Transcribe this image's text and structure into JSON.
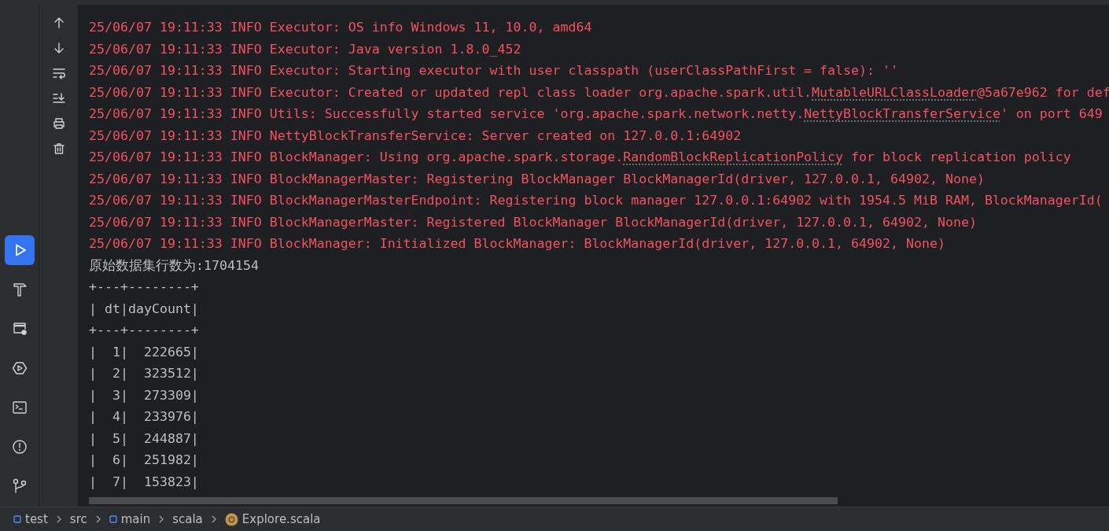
{
  "tool_windows": [
    {
      "kind": "run",
      "selected": true
    },
    {
      "kind": "build",
      "selected": false
    },
    {
      "kind": "services",
      "selected": false
    },
    {
      "kind": "deploy",
      "selected": false
    },
    {
      "kind": "terminal",
      "selected": false
    },
    {
      "kind": "problems",
      "selected": false
    },
    {
      "kind": "git",
      "selected": false
    }
  ],
  "console": {
    "lines": [
      {
        "kind": "log",
        "segments": [
          {
            "text": "25/06/07 19:11:33 INFO Executor: OS info Windows 11, 10.0, amd64"
          }
        ]
      },
      {
        "kind": "log",
        "segments": [
          {
            "text": "25/06/07 19:11:33 INFO Executor: Java version 1.8.0_452"
          }
        ]
      },
      {
        "kind": "log",
        "segments": [
          {
            "text": "25/06/07 19:11:33 INFO Executor: Starting executor with user classpath (userClassPathFirst = false): ''"
          }
        ]
      },
      {
        "kind": "log",
        "segments": [
          {
            "text": "25/06/07 19:11:33 INFO Executor: Created or updated repl class loader org.apache.spark.util."
          },
          {
            "text": "MutableURLClassLoader",
            "link": true
          },
          {
            "text": "@5a67e962 for def"
          }
        ]
      },
      {
        "kind": "log",
        "segments": [
          {
            "text": "25/06/07 19:11:33 INFO Utils: Successfully started service 'org.apache.spark.network.netty."
          },
          {
            "text": "NettyBlockTransferService",
            "link": true
          },
          {
            "text": "' on port 649"
          }
        ]
      },
      {
        "kind": "log",
        "segments": [
          {
            "text": "25/06/07 19:11:33 INFO NettyBlockTransferService: Server created on 127.0.0.1:64902"
          }
        ]
      },
      {
        "kind": "log",
        "segments": [
          {
            "text": "25/06/07 19:11:33 INFO BlockManager: Using org.apache.spark.storage."
          },
          {
            "text": "RandomBlockReplicationPolicy",
            "link": true
          },
          {
            "text": " for block replication policy"
          }
        ]
      },
      {
        "kind": "log",
        "segments": [
          {
            "text": "25/06/07 19:11:33 INFO BlockManagerMaster: Registering BlockManager BlockManagerId(driver, 127.0.0.1, 64902, None)"
          }
        ]
      },
      {
        "kind": "log",
        "segments": [
          {
            "text": "25/06/07 19:11:33 INFO BlockManagerMasterEndpoint: Registering block manager 127.0.0.1:64902 with 1954.5 MiB RAM, BlockManagerId("
          }
        ]
      },
      {
        "kind": "log",
        "segments": [
          {
            "text": "25/06/07 19:11:33 INFO BlockManagerMaster: Registered BlockManager BlockManagerId(driver, 127.0.0.1, 64902, None)"
          }
        ]
      },
      {
        "kind": "log",
        "segments": [
          {
            "text": "25/06/07 19:11:33 INFO BlockManager: Initialized BlockManager: BlockManagerId(driver, 127.0.0.1, 64902, None)"
          }
        ]
      },
      {
        "kind": "out",
        "segments": [
          {
            "text": "原始数据集行数为:1704154"
          }
        ]
      },
      {
        "kind": "out",
        "segments": [
          {
            "text": "+---+--------+"
          }
        ]
      },
      {
        "kind": "out",
        "segments": [
          {
            "text": "| dt|dayCount|"
          }
        ]
      },
      {
        "kind": "out",
        "segments": [
          {
            "text": "+---+--------+"
          }
        ]
      },
      {
        "kind": "out",
        "segments": [
          {
            "text": "|  1|  222665|"
          }
        ]
      },
      {
        "kind": "out",
        "segments": [
          {
            "text": "|  2|  323512|"
          }
        ]
      },
      {
        "kind": "out",
        "segments": [
          {
            "text": "|  3|  273309|"
          }
        ]
      },
      {
        "kind": "out",
        "segments": [
          {
            "text": "|  4|  233976|"
          }
        ]
      },
      {
        "kind": "out",
        "segments": [
          {
            "text": "|  5|  244887|"
          }
        ]
      },
      {
        "kind": "out",
        "segments": [
          {
            "text": "|  6|  251982|"
          }
        ]
      },
      {
        "kind": "out",
        "segments": [
          {
            "text": "|  7|  153823|"
          }
        ]
      }
    ]
  },
  "breadcrumb": [
    {
      "label": "test",
      "kind": "module"
    },
    {
      "label": "src",
      "kind": "folder"
    },
    {
      "label": "main",
      "kind": "module"
    },
    {
      "label": "scala",
      "kind": "folder"
    },
    {
      "label": "Explore.scala",
      "kind": "file"
    }
  ]
}
